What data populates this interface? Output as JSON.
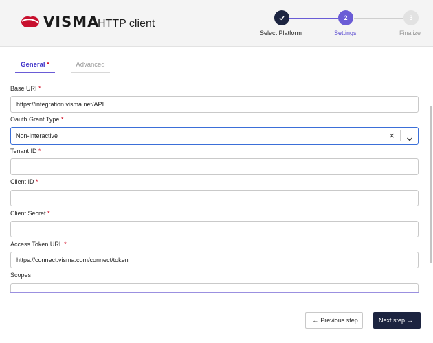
{
  "header": {
    "brand": "VISMA",
    "title": "HTTP client"
  },
  "stepper": {
    "steps": [
      {
        "number": "",
        "label": "Select Platform",
        "state": "completed",
        "icon": "check-icon"
      },
      {
        "number": "2",
        "label": "Settings",
        "state": "active"
      },
      {
        "number": "3",
        "label": "Finalize",
        "state": "pending"
      }
    ]
  },
  "tabs": [
    {
      "label": "General",
      "required": "*",
      "active": true
    },
    {
      "label": "Advanced",
      "active": false
    }
  ],
  "form": {
    "required_mark": "*",
    "base_uri": {
      "label": "Base URI",
      "value": "https://integration.visma.net/API"
    },
    "grant_type": {
      "label": "Oauth Grant Type",
      "value": "Non-Interactive"
    },
    "tenant_id": {
      "label": "Tenant ID",
      "value": ""
    },
    "client_id": {
      "label": "Client ID",
      "value": ""
    },
    "client_secret": {
      "label": "Client Secret",
      "value": ""
    },
    "access_token_url": {
      "label": "Access Token URL",
      "value": "https://connect.visma.com/connect/token"
    },
    "scopes": {
      "label": "Scopes",
      "value": ""
    }
  },
  "footer": {
    "prev_label": "Previous step",
    "next_label": "Next step"
  },
  "colors": {
    "accent": "#6a5cd6",
    "brand_red": "#c8102e",
    "dark_navy": "#1c2440",
    "select_border": "#3b6fd8",
    "required": "#d0021b"
  }
}
